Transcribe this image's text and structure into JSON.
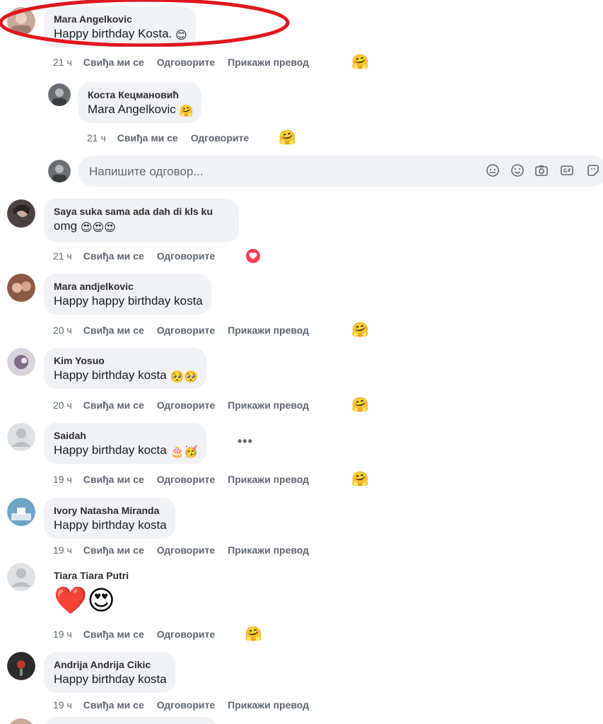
{
  "actions": {
    "like": "Свиђа ми се",
    "reply": "Одговорите",
    "translate": "Прикажи превод"
  },
  "reply_box": {
    "placeholder": "Напишите одговор..."
  },
  "comments": [
    {
      "author": "Mara Angelkovic",
      "text": "Happy birthday Kosta.",
      "emoji": "😊",
      "time": "21 ч",
      "reaction": "care"
    },
    {
      "author": "Коста Кецмановић",
      "text": "Mara Angelkovic",
      "emoji": "🤗",
      "time": "21 ч",
      "reaction": "care",
      "is_reply": true
    },
    {
      "author": "Saya suka sama ada dah di kls ku",
      "text": "omg",
      "emoji": "😍😍😍",
      "time": "21 ч",
      "reaction": "love"
    },
    {
      "author": "Mara andjelkovic",
      "text": "Happy happy birthday kosta",
      "emoji": "",
      "time": "20 ч",
      "reaction": "care"
    },
    {
      "author": "Kim Yosuo",
      "text": "Happy birthday kosta",
      "emoji": "🥺🥺",
      "time": "20 ч",
      "reaction": "care"
    },
    {
      "author": "Saidah",
      "text": "Happy birthday kocta",
      "emoji": "🎂🥳",
      "time": "19 ч",
      "reaction": "care"
    },
    {
      "author": "Ivory Natasha Miranda",
      "text": "Happy birthday kosta",
      "emoji": "",
      "time": "19 ч",
      "reaction": ""
    },
    {
      "author": "Tiara Tiara Putri",
      "text": "",
      "emoji": "❤️😍",
      "time": "19 ч",
      "reaction": "care"
    },
    {
      "author": "Andrija Andrija Cikic",
      "text": "Happy birthday kosta",
      "emoji": "",
      "time": "19 ч",
      "reaction": ""
    }
  ],
  "colors": {
    "bubble": "#f0f2f5",
    "meta": "#606770",
    "highlight": "#e0161e",
    "love": "#f33e58"
  },
  "icons": [
    "sticker-face-icon",
    "emoji-icon",
    "camera-icon",
    "gif-icon",
    "sticker-icon",
    "more-icon"
  ]
}
